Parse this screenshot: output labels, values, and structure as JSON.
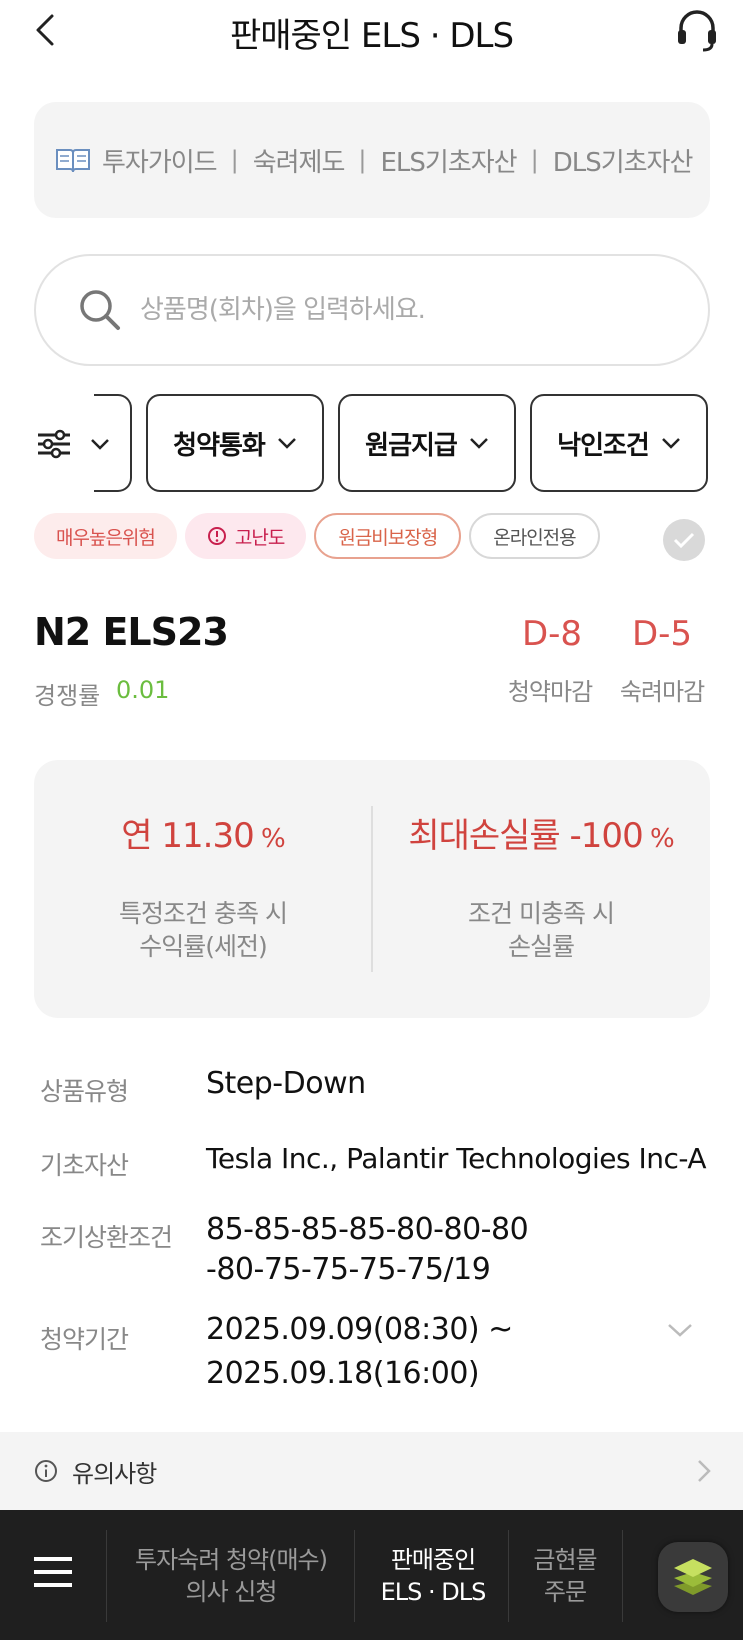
{
  "header": {
    "title": "판매중인 ELS · DLS",
    "back_icon": "chevron-left-icon",
    "support_icon": "headset-icon"
  },
  "guide": {
    "icon": "book-icon",
    "items": [
      "투자가이드",
      "숙려제도",
      "ELS기초자산",
      "DLS기초자산"
    ],
    "separator": "|"
  },
  "search": {
    "placeholder": "상품명(회차)을 입력하세요."
  },
  "filters": {
    "items": [
      {
        "label": "청약통화"
      },
      {
        "label": "원금지급"
      },
      {
        "label": "낙인조건"
      }
    ]
  },
  "tags": {
    "risk": "매우높은위험",
    "difficulty": "고난도",
    "non_principal": "원금비보장형",
    "online": "온라인전용"
  },
  "product": {
    "name": "N2 ELS23",
    "competition_label": "경쟁률",
    "competition_value": "0.01",
    "dday_subscription": "D-8",
    "dday_subscription_label": "청약마감",
    "dday_deliberation": "D-5",
    "dday_deliberation_label": "숙려마감"
  },
  "yield": {
    "left_prefix": "연 ",
    "left_value": "11.30",
    "left_unit": " %",
    "left_sub1": "특정조건 충족 시",
    "left_sub2": "수익률(세전)",
    "right_prefix": "최대손실률 ",
    "right_value": "-100",
    "right_unit": " %",
    "right_sub1": "조건 미충족 시",
    "right_sub2": "손실률"
  },
  "details": {
    "type_label": "상품유형",
    "type_value": "Step-Down",
    "asset_label": "기초자산",
    "asset_value": "Tesla Inc., Palantir Technologies Inc-A",
    "redemption_label": "조기상환조건",
    "redemption_line1": "85-85-85-85-80-80-80",
    "redemption_line2": "-80-75-75-75-75/19",
    "period_label": "청약기간",
    "period_line1": "2025.09.09(08:30) ~",
    "period_line2": "2025.09.18(16:00)"
  },
  "notice": {
    "label": "유의사항"
  },
  "bottom_nav": {
    "items": [
      {
        "line1": "투자숙려 청약(매수)",
        "line2": "의사 신청"
      },
      {
        "line1": "판매중인",
        "line2": "ELS · DLS"
      },
      {
        "line1": "금현물",
        "line2": "주문"
      }
    ],
    "active_color": "#ffffff",
    "inactive_color": "#9a9a9a"
  },
  "colors": {
    "accent_red": "#d0433e",
    "green": "#6bbd3f"
  }
}
